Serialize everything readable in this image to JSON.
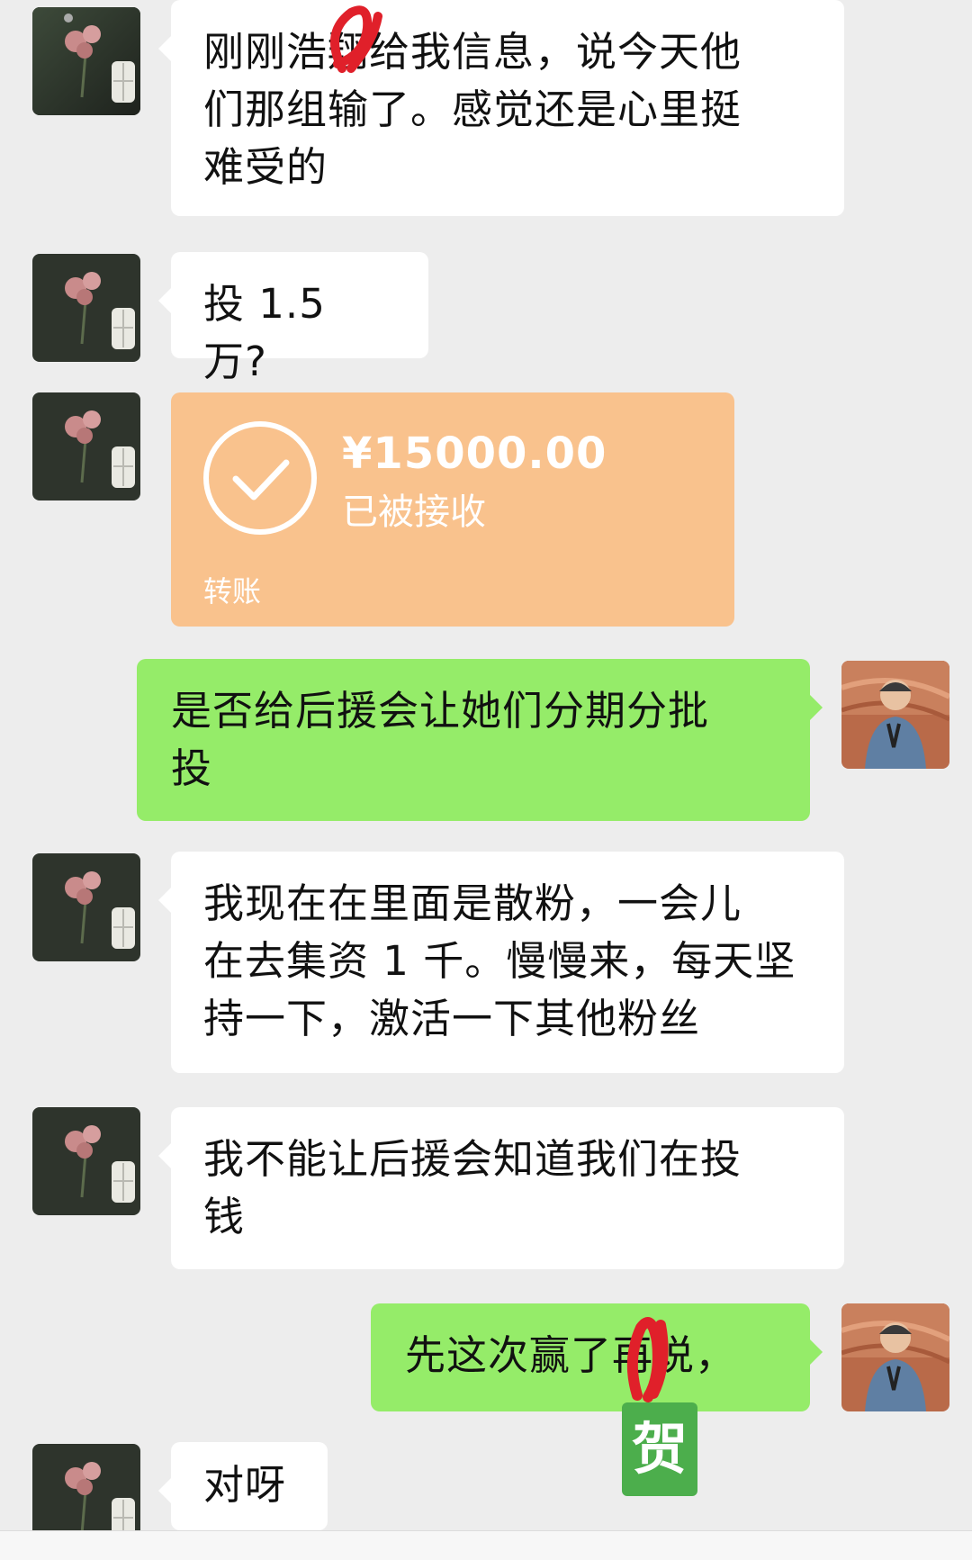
{
  "messages": [
    {
      "side": "left",
      "type": "text",
      "text": "刚刚浩翔给我信息，说今天他\n们那组输了。感觉还是心里挺\n难受的"
    },
    {
      "side": "left",
      "type": "text",
      "text": "投 1.5 万?"
    },
    {
      "side": "left",
      "type": "transfer",
      "amount": "¥15000.00",
      "status": "已被接收",
      "label": "转账"
    },
    {
      "side": "right",
      "type": "text",
      "text": "是否给后援会让她们分期分批\n投"
    },
    {
      "side": "left",
      "type": "text",
      "text": "我现在在里面是散粉，一会儿\n在去集资 1 千。慢慢来，每天坚\n持一下，激活一下其他粉丝"
    },
    {
      "side": "left",
      "type": "text",
      "text": "我不能让后援会知道我们在投\n钱"
    },
    {
      "side": "right",
      "type": "text",
      "text": "先这次赢了再说，"
    },
    {
      "side": "left",
      "type": "text",
      "text": "对呀"
    }
  ],
  "overlay_tag": "贺",
  "colors": {
    "background": "#ededed",
    "incoming_bubble": "#ffffff",
    "outgoing_bubble": "#95ec69",
    "transfer_card": "#f9c28d",
    "redaction": "#e0202a",
    "tag": "#4cae4c"
  },
  "icons": {
    "contact_avatar": "flower-vase-avatar",
    "self_avatar": "person-photo-avatar",
    "transfer_received": "check-circle-icon"
  }
}
